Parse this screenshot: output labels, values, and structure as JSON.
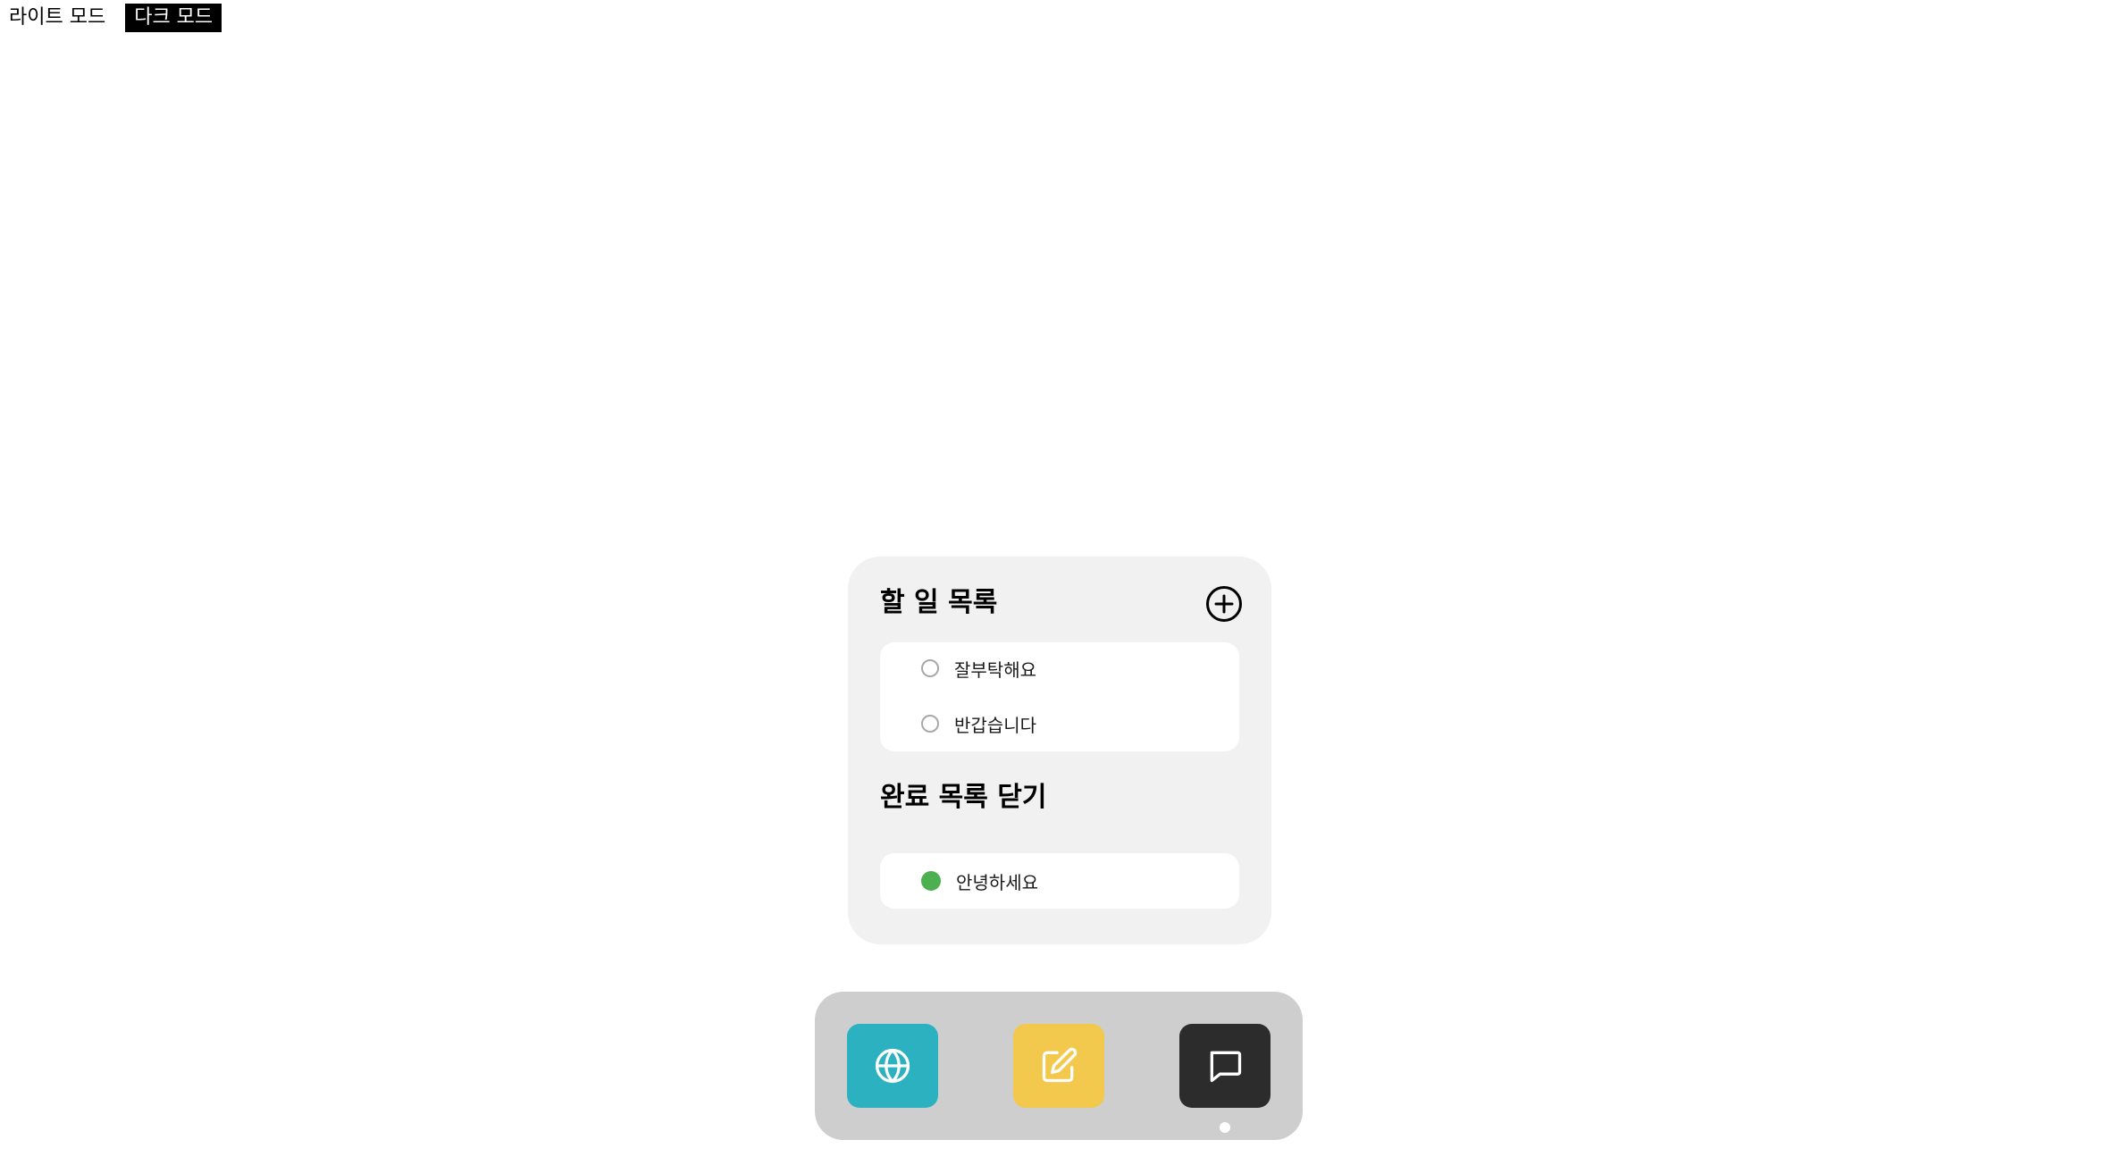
{
  "mode_toggle": {
    "light_label": "라이트 모드",
    "dark_label": "다크 모드"
  },
  "todo_widget": {
    "title": "할 일 목록",
    "add_icon": "plus-circle-icon",
    "todo_items": [
      {
        "text": "잘부탁해요",
        "done": false
      },
      {
        "text": "반갑습니다",
        "done": false
      }
    ],
    "done_title": "완료 목록 닫기",
    "done_items": [
      {
        "text": "안녕하세요",
        "done": true
      }
    ],
    "colors": {
      "widget_bg": "#f1f1f1",
      "card_bg": "#ffffff",
      "done_check": "#4caf50",
      "empty_check_border": "#a8a8a8"
    }
  },
  "dock": {
    "apps": [
      {
        "icon": "globe-icon",
        "color": "#2cb1c1"
      },
      {
        "icon": "edit-icon",
        "color": "#f2c94c"
      },
      {
        "icon": "chat-icon",
        "color": "#2c2c2c"
      }
    ],
    "active_index": 2,
    "background": "#cecece"
  }
}
